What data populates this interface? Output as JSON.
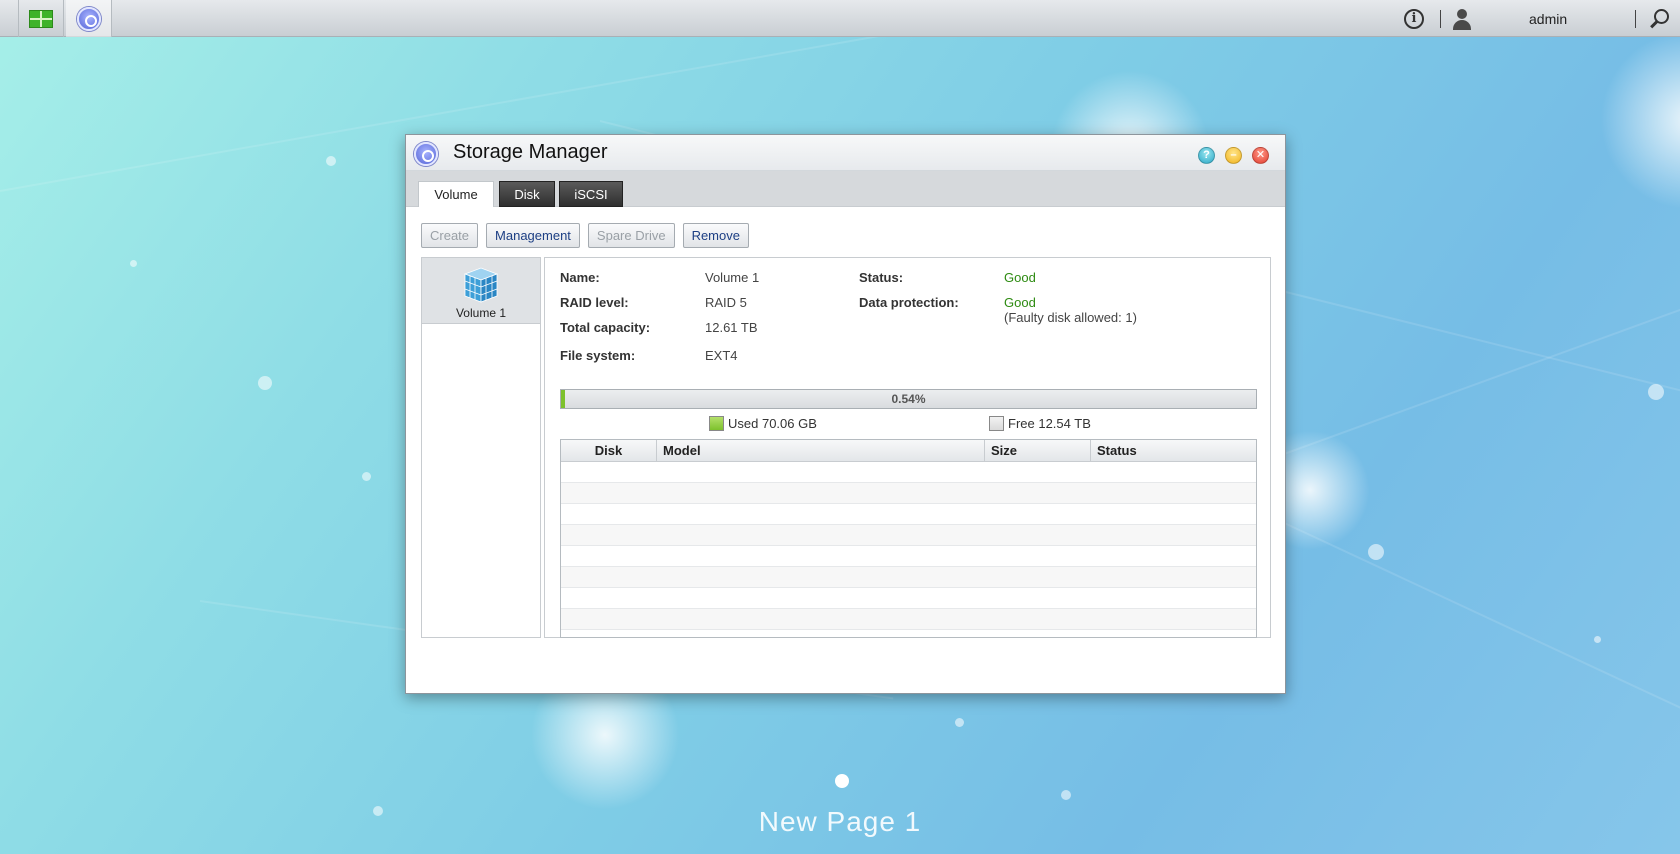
{
  "taskbar": {
    "user_label": "admin"
  },
  "window": {
    "title": "Storage Manager",
    "tabs": [
      {
        "label": "Volume",
        "active": true
      },
      {
        "label": "Disk",
        "active": false
      },
      {
        "label": "iSCSI",
        "active": false
      }
    ],
    "toolbar": {
      "create": "Create",
      "management": "Management",
      "spare_drive": "Spare Drive",
      "remove": "Remove"
    },
    "volumes": [
      {
        "label": "Volume 1",
        "selected": true
      }
    ],
    "details": {
      "name_label": "Name:",
      "name_value": "Volume 1",
      "raid_label": "RAID level:",
      "raid_value": "RAID 5",
      "capacity_label": "Total capacity:",
      "capacity_value": "12.61 TB",
      "fs_label": "File system:",
      "fs_value": "EXT4",
      "status_label": "Status:",
      "status_value": "Good",
      "protection_label": "Data protection:",
      "protection_value": "Good",
      "protection_note": "(Faulty disk allowed: 1)"
    },
    "usage": {
      "percent_text": "0.54%",
      "percent": 0.54,
      "used_label": "Used 70.06 GB",
      "free_label": "Free 12.54 TB"
    },
    "disk_table": {
      "columns": [
        "Disk",
        "Model",
        "Size",
        "Status"
      ],
      "rows": []
    }
  },
  "desktop": {
    "page_label": "New Page 1"
  },
  "colors": {
    "good": "#2e8b12",
    "used": "#7dc12d",
    "accent_link": "#1d3f84"
  }
}
